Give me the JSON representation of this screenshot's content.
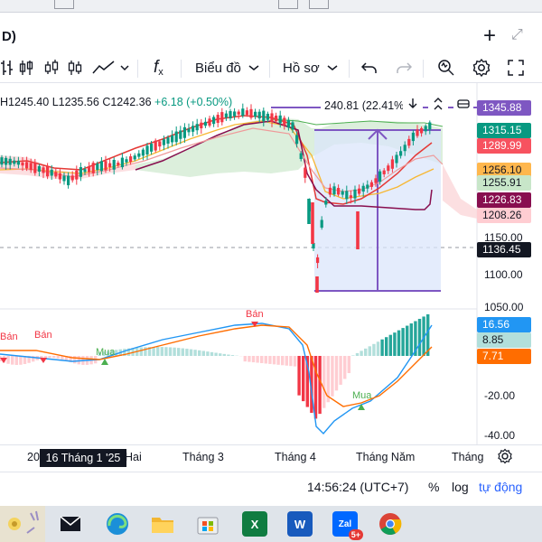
{
  "window": {
    "title_suffix": "D)"
  },
  "toolbar": {
    "chart_type_label": "Biểu đồ",
    "profile_label": "Hồ sơ",
    "fx_label": "f",
    "fx_sub": "x"
  },
  "ohlc": {
    "h": "H1245.40",
    "l": "L1235.56",
    "c": "C1242.36",
    "change": "+6.18 (+0.50%)"
  },
  "measure": {
    "text": "240.81 (22.41%) 2"
  },
  "price_labels": [
    {
      "value": "1345.88",
      "bg": "#7e57c2",
      "fg": "#ffffff"
    },
    {
      "value": "1315.15",
      "bg": "#089981",
      "fg": "#ffffff"
    },
    {
      "value": "1289.99",
      "bg": "#f7525f",
      "fg": "#ffffff"
    },
    {
      "value": "1256.10",
      "bg": "#ffb74d",
      "fg": "#131722"
    },
    {
      "value": "1255.91",
      "bg": "#c8e6c9",
      "fg": "#131722"
    },
    {
      "value": "1226.83",
      "bg": "#880e4f",
      "fg": "#ffffff"
    },
    {
      "value": "1208.26",
      "bg": "#ffcdd2",
      "fg": "#131722"
    },
    {
      "value": "1136.45",
      "bg": "#131722",
      "fg": "#ffffff"
    }
  ],
  "price_axis": [
    "1150.00",
    "1100.00",
    "1050.00"
  ],
  "indicator_labels": [
    {
      "value": "16.56",
      "bg": "#2196f3",
      "fg": "#ffffff"
    },
    {
      "value": "8.85",
      "bg": "#b2dfdb",
      "fg": "#131722"
    },
    {
      "value": "7.71",
      "bg": "#ff6d00",
      "fg": "#ffffff"
    }
  ],
  "indicator_axis": [
    "-20.00",
    "-40.00"
  ],
  "signals": {
    "sell1": "Bán",
    "sell2": "Bán",
    "sell3": "Bán",
    "buy1": "Mua",
    "buy2": "Mua"
  },
  "xaxis": {
    "highlight": "16 Tháng 1 '25",
    "labels": [
      "20",
      "Hai",
      "Tháng 3",
      "Tháng 4",
      "Tháng Năm",
      "Tháng"
    ]
  },
  "bottom": {
    "time": "14:56:24 (UTC+7)",
    "percent": "%",
    "log": "log",
    "auto": "tự động"
  },
  "colors": {
    "up": "#089981",
    "down": "#f23645",
    "measure_fill": "#dbe6fb",
    "measure_line": "#7e57c2"
  },
  "taskbar": {
    "items": [
      "desktop-thumbnail",
      "mail",
      "edge",
      "file-explorer",
      "store",
      "excel",
      "word",
      "zalo",
      "chrome"
    ],
    "excel_label": "X",
    "word_label": "W",
    "zalo_label": "Zal",
    "zalo_badge": "5+"
  }
}
